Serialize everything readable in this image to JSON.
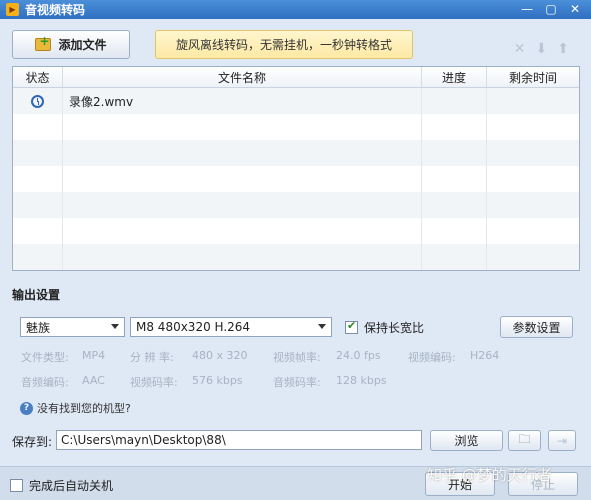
{
  "window": {
    "title": "音视频转码",
    "controls": [
      "—",
      "▢",
      "✕"
    ]
  },
  "toolbar": {
    "add_label": "添加文件",
    "promo_text": "旋风离线转码，无需挂机，一秒钟转格式",
    "icons": [
      "delete-icon",
      "move-down-icon",
      "move-up-icon"
    ]
  },
  "table": {
    "headers": [
      "状态",
      "文件名称",
      "进度",
      "剩余时间"
    ],
    "rows": [
      {
        "status_icon": "clock-icon",
        "name": "录像2.wmv",
        "progress": "",
        "remaining": ""
      }
    ]
  },
  "output": {
    "section_title": "输出设置",
    "brand": "魅族",
    "model": "M8 480x320 H.264",
    "keep_ratio_label": "保持长宽比",
    "keep_ratio_checked": true,
    "param_btn": "参数设置",
    "info": {
      "file_type_label": "文件类型:",
      "file_type": "MP4",
      "resolution_label": "分 辨 率:",
      "resolution": "480 x 320",
      "framerate_label": "视频帧率:",
      "framerate": "24.0 fps",
      "vcodec_label": "视频编码:",
      "vcodec": "H264",
      "acodec_label": "音频编码:",
      "acodec": "AAC",
      "vbitrate_label": "视频码率:",
      "vbitrate": "576 kbps",
      "abitrate_label": "音频码率:",
      "abitrate": "128 kbps"
    },
    "help_text": "没有找到您的机型?"
  },
  "save": {
    "label": "保存到:",
    "path": "C:\\Users\\mayn\\Desktop\\88\\",
    "browse_btn": "浏览"
  },
  "footer": {
    "shutdown_label": "完成后自动关机",
    "start_btn": "开始",
    "stop_btn": "停止"
  },
  "watermark": "知乎 @梦的天行者"
}
